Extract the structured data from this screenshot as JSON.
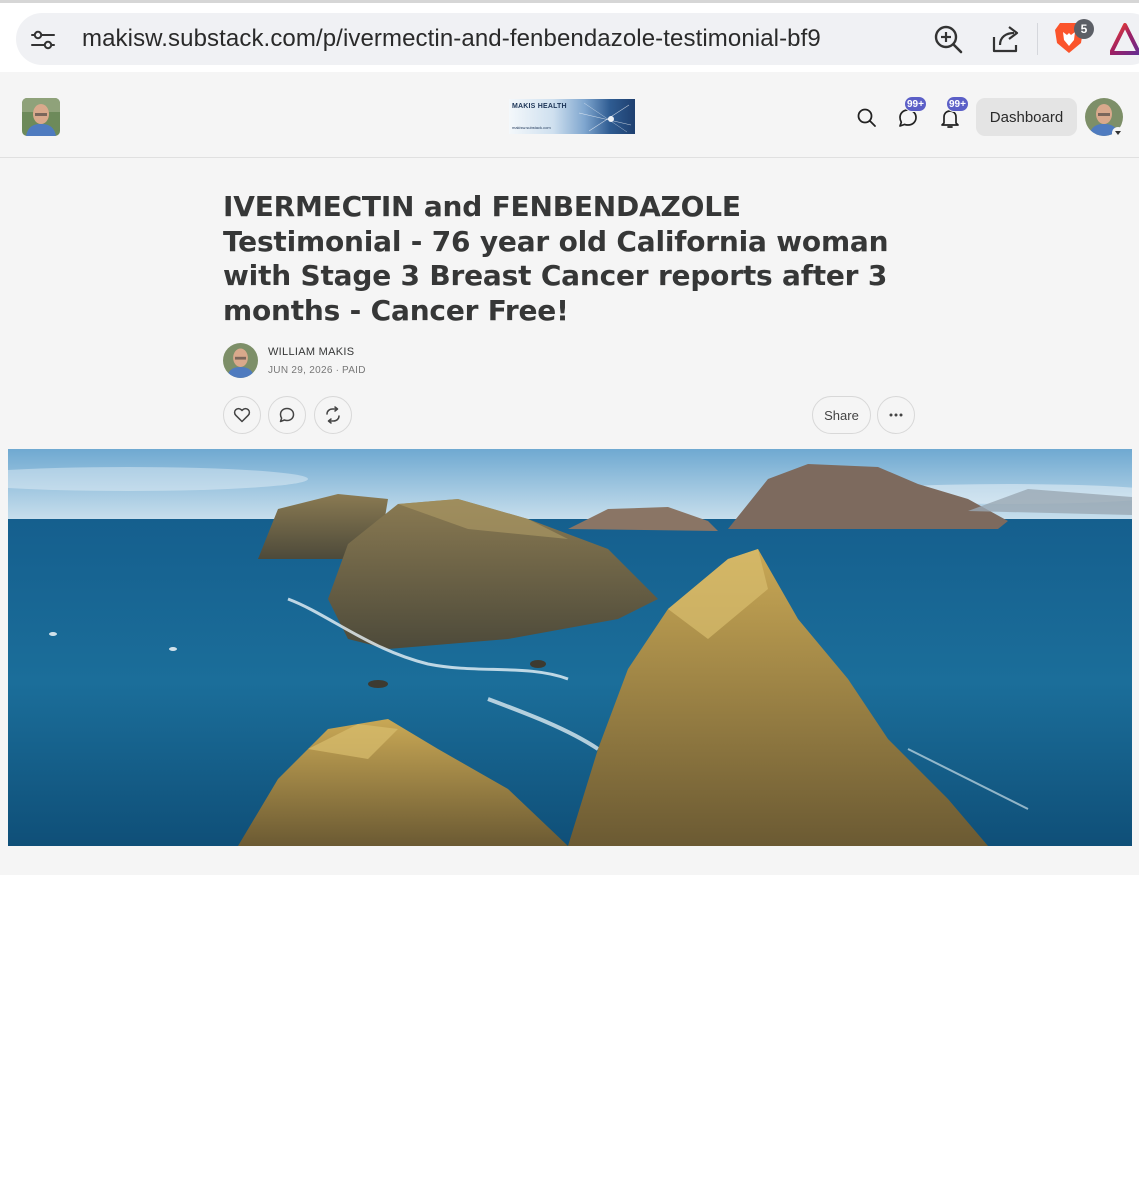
{
  "browser": {
    "url": "makisw.substack.com/p/ivermectin-and-fenbendazole-testimonial-bf9",
    "extension_badge": "5",
    "icons": [
      "tune-icon",
      "zoom-in-icon",
      "share-icon",
      "brave-lion-icon",
      "brave-rewards-icon"
    ]
  },
  "header": {
    "logo_title": "MAKIS HEALTH",
    "logo_subtitle": "makisw.substack.com",
    "chat_badge": "99+",
    "notifications_badge": "99+",
    "dashboard_label": "Dashboard"
  },
  "post": {
    "title": "IVERMECTIN and FENBENDAZOLE Testimonial - 76 year old California woman with Stage 3 Breast Cancer reports after 3 months - Cancer Free!",
    "author": "WILLIAM MAKIS",
    "meta": "JUN 29, 2026 ∙ PAID",
    "share_label": "Share"
  },
  "colors": {
    "accent_badge": "#5b5fc7",
    "brave_orange": "#fb542b",
    "page_bg": "#f5f5f5",
    "title_text": "#363737"
  }
}
